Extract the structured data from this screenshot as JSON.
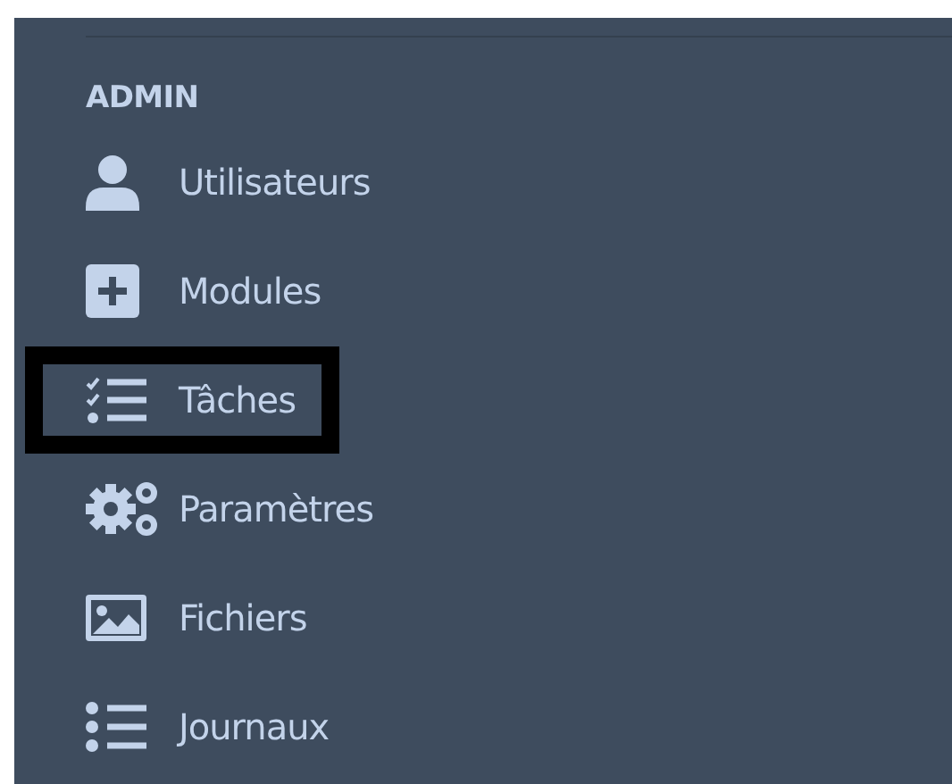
{
  "sidebar": {
    "section_title": "ADMIN",
    "items": [
      {
        "label": "Utilisateurs",
        "kind": "user",
        "selected": false
      },
      {
        "label": "Modules",
        "kind": "plus",
        "selected": false
      },
      {
        "label": "Tâches",
        "kind": "tasks",
        "selected": true
      },
      {
        "label": "Paramètres",
        "kind": "gears",
        "selected": false
      },
      {
        "label": "Fichiers",
        "kind": "image",
        "selected": false
      },
      {
        "label": "Journaux",
        "kind": "list",
        "selected": false
      }
    ]
  }
}
